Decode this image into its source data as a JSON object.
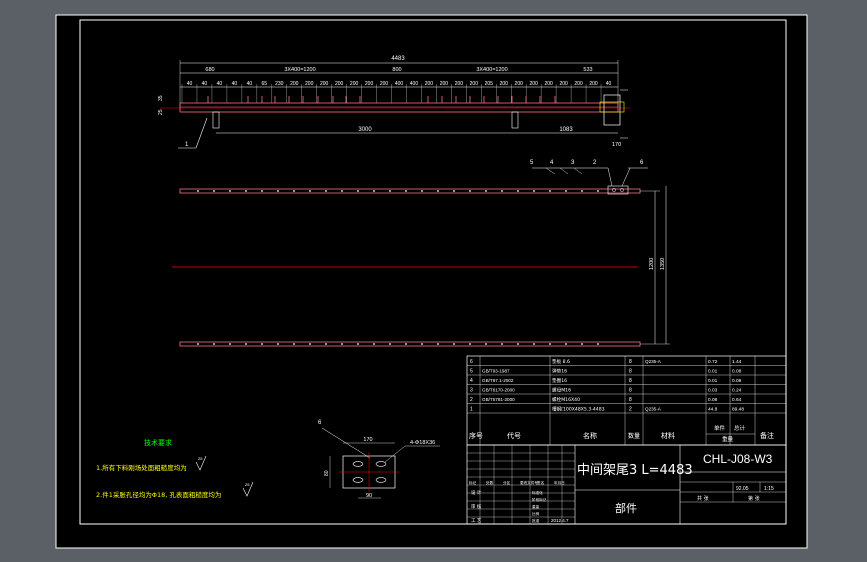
{
  "dimensions": {
    "overall": "4483",
    "seg_top": [
      "680",
      "3X400=1200",
      "800",
      "3X400=1200",
      "533"
    ],
    "seg_small": [
      "40",
      "40",
      "40",
      "40",
      "40",
      "65",
      "230",
      "200",
      "200",
      "200",
      "200",
      "200",
      "200",
      "200",
      "400",
      "400",
      "200",
      "200",
      "200",
      "200",
      "205",
      "200",
      "200",
      "200",
      "200",
      "200",
      "200",
      "200",
      "40"
    ],
    "span": "3000",
    "tail": "1083",
    "height_a": "1200",
    "height_b": "1350",
    "right_small": "170",
    "left_small": [
      "35",
      "25"
    ]
  },
  "leaders": {
    "front": [
      "1"
    ],
    "plan": [
      "5",
      "4",
      "3",
      "2",
      "6"
    ]
  },
  "detail": {
    "label": "6",
    "width_top": "170",
    "width_bottom": "90",
    "left": "80",
    "hole_note": "4-Φ18X36"
  },
  "tech": {
    "title": "技术要求",
    "line1": "1.所有下料刚场处面粗糙度均为",
    "line1_sym": "25",
    "line2": "2.件1采胀孔径均为Φ18, 孔表面粗糙度均为",
    "line2_sym": "25"
  },
  "bom": {
    "rows": [
      {
        "no": "6",
        "code": "",
        "name": "垫板 8.6",
        "qty": "8",
        "mat": "Q235-A",
        "w1": "0.72",
        "w2": "1.44"
      },
      {
        "no": "5",
        "code": "GB/T93-1987",
        "name": "弹垫16",
        "qty": "8",
        "mat": "",
        "w1": "0.01",
        "w2": "0.08"
      },
      {
        "no": "4",
        "code": "GB/T97.1-2002",
        "name": "垫圈16",
        "qty": "8",
        "mat": "",
        "w1": "0.01",
        "w2": "0.08"
      },
      {
        "no": "3",
        "code": "GB/T6170-2000",
        "name": "螺母M16",
        "qty": "8",
        "mat": "",
        "w1": "0.03",
        "w2": "0.24"
      },
      {
        "no": "2",
        "code": "GB/T5781-2000",
        "name": "螺栓M16X40",
        "qty": "8",
        "mat": "",
        "w1": "0.08",
        "w2": "0.64"
      },
      {
        "no": "1",
        "code": "",
        "name": "槽钢[100X48X5.3-4483",
        "qty": "2",
        "mat": "Q235-A",
        "w1": "44.8",
        "w2": "89.48"
      }
    ],
    "headers": {
      "no": "序号",
      "code": "代号",
      "name": "名称",
      "qty": "数量",
      "mat": "材料",
      "unit": "单件",
      "total": "总计",
      "weight": "重量",
      "note": "备注"
    }
  },
  "title_block": {
    "part_name": "中间架尾3 L=4483",
    "drawing_no": "CHL-J08-W3",
    "category": "部件",
    "weight": "92.05",
    "scale": "1:15",
    "sheet": "共 张",
    "sheet2": "第 张",
    "labels": [
      "标记",
      "处数",
      "分区",
      "更改文件号",
      "签名",
      "年月日"
    ],
    "roles": [
      "设 计",
      "审 核",
      "工 艺"
    ],
    "sub_labels": [
      "标准化",
      "阶段标记",
      "重量",
      "比例",
      "批准"
    ],
    "date": "2012.4.7"
  },
  "colors": {
    "sheet": "#000000",
    "line": "#ffffff",
    "dim": "#00ffff",
    "center": "#ff0000",
    "part": "#ff6f8a",
    "yellow": "#ffff00",
    "green": "#00ff00"
  }
}
